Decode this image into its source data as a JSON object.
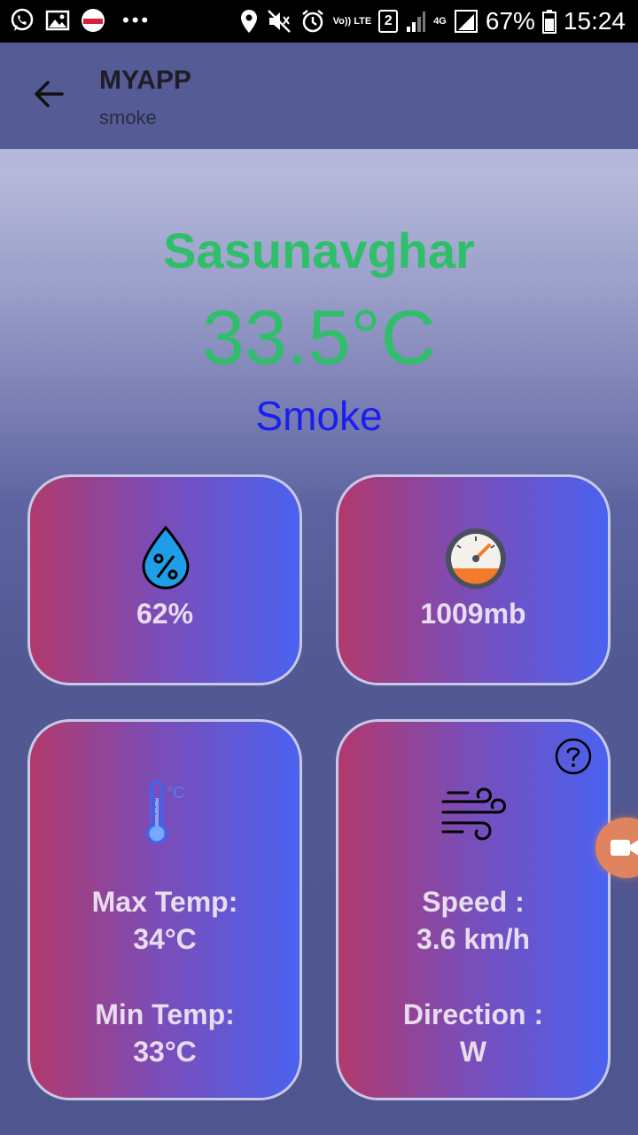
{
  "status_bar": {
    "battery": "67%",
    "time": "15:24",
    "sim": "2",
    "volte": "Vo)) LTE",
    "network": "4G",
    "icons": [
      "whatsapp-icon",
      "gallery-icon",
      "app-badge-icon",
      "more-dots-icon",
      "location-icon",
      "mute-icon",
      "alarm-icon",
      "signal-icon",
      "battery-icon"
    ]
  },
  "appbar": {
    "title": "MYAPP",
    "subtitle": "smoke",
    "back_icon": "arrow-back-icon"
  },
  "weather": {
    "city": "Sasunavghar",
    "temperature": "33.5°C",
    "condition": "Smoke"
  },
  "cards": {
    "humidity": {
      "value": "62%",
      "icon": "humidity-drop-icon"
    },
    "pressure": {
      "value": "1009mb",
      "icon": "gauge-icon"
    },
    "temperature": {
      "icon": "thermometer-icon",
      "max_label": "Max Temp:",
      "max_value": "34°C",
      "min_label": "Min Temp:",
      "min_value": "33°C"
    },
    "wind": {
      "icon": "wind-icon",
      "help_icon": "help-icon",
      "speed_label": "Speed :",
      "speed_value": "3.6 km/h",
      "direction_label": "Direction :",
      "direction_value": "W"
    }
  },
  "floating_button": {
    "icon": "video-camera-icon"
  },
  "colors": {
    "accent_green": "#2fbe6a",
    "condition_blue": "#1a1ff0",
    "appbar": "#555b94",
    "card_gradient_start": "#b1396d",
    "card_gradient_end": "#4a62f0"
  }
}
